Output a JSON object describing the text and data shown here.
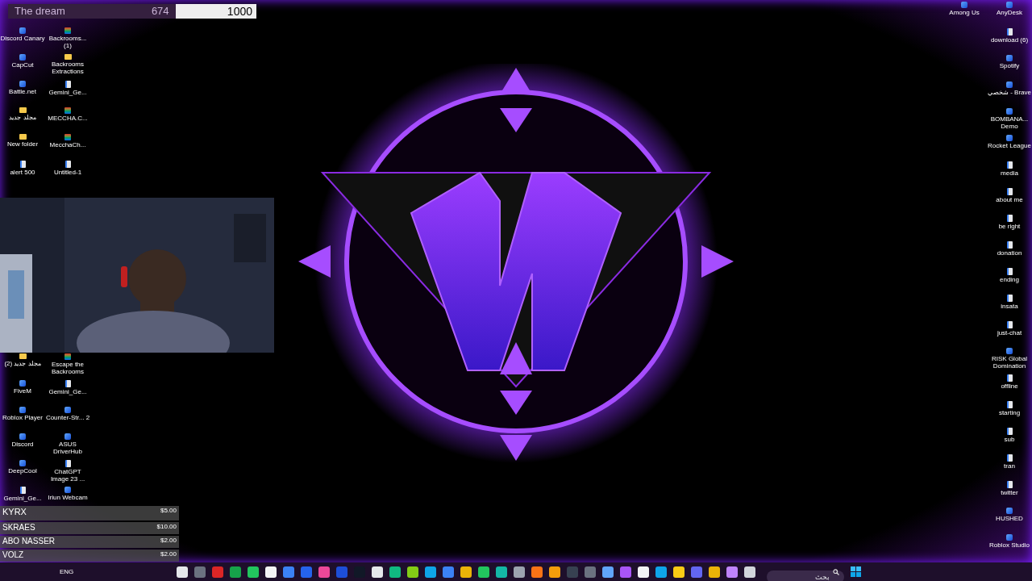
{
  "goal": {
    "title": "The dream",
    "current": "674",
    "target": "1000",
    "level": 0.674
  },
  "left_top": [
    {
      "label": "Discord Canary",
      "kind": "app"
    },
    {
      "label": "Backrooms... (1)",
      "kind": "archive"
    },
    {
      "label": "CapCut",
      "kind": "app"
    },
    {
      "label": "Backrooms Extractions",
      "kind": "folder"
    },
    {
      "label": "Battle.net",
      "kind": "app"
    },
    {
      "label": "Gemini_Ge...",
      "kind": "file"
    },
    {
      "label": "مجلد جديد",
      "kind": "folder"
    },
    {
      "label": "MECCHA.C...",
      "kind": "archive"
    },
    {
      "label": "New folder",
      "kind": "folder"
    },
    {
      "label": "MecchaCh...",
      "kind": "archive"
    },
    {
      "label": "alert 500",
      "kind": "file"
    },
    {
      "label": "Untitled-1",
      "kind": "file"
    }
  ],
  "left_bottom": [
    {
      "label": "مجلد جديد (2)",
      "kind": "folder"
    },
    {
      "label": "Escape the Backrooms",
      "kind": "archive"
    },
    {
      "label": "FiveM",
      "kind": "app"
    },
    {
      "label": "Gemini_Ge...",
      "kind": "file"
    },
    {
      "label": "Roblox Player",
      "kind": "app"
    },
    {
      "label": "Counter-Str... 2",
      "kind": "app"
    },
    {
      "label": "Discord",
      "kind": "app"
    },
    {
      "label": "ASUS DriverHub",
      "kind": "app"
    },
    {
      "label": "DeepCool",
      "kind": "app"
    },
    {
      "label": "ChatGPT Image 23 ...",
      "kind": "file"
    },
    {
      "label": "Gemini_Ge...",
      "kind": "file"
    },
    {
      "label": "Iriun Webcam",
      "kind": "app"
    }
  ],
  "right_top": [
    {
      "label": "Among Us",
      "kind": "app"
    },
    {
      "label": "AnyDesk",
      "kind": "app"
    }
  ],
  "right_column": [
    {
      "label": "download (6)",
      "kind": "file"
    },
    {
      "label": "Spotify",
      "kind": "app"
    },
    {
      "label": "شخصي - Brave",
      "kind": "app"
    },
    {
      "label": "BOMBANA... Demo",
      "kind": "app"
    },
    {
      "label": "Rocket League",
      "kind": "app"
    },
    {
      "label": "media",
      "kind": "file"
    },
    {
      "label": "about me",
      "kind": "file"
    },
    {
      "label": "be right",
      "kind": "file"
    },
    {
      "label": "donation",
      "kind": "file"
    },
    {
      "label": "ending",
      "kind": "file"
    },
    {
      "label": "insata",
      "kind": "file"
    },
    {
      "label": "just-chat",
      "kind": "file"
    },
    {
      "label": "RISK Global Domination",
      "kind": "app"
    },
    {
      "label": "offline",
      "kind": "file"
    },
    {
      "label": "starting",
      "kind": "file"
    },
    {
      "label": "sub",
      "kind": "file"
    },
    {
      "label": "tran",
      "kind": "file"
    },
    {
      "label": "twitter",
      "kind": "file"
    },
    {
      "label": "HUSHED",
      "kind": "app"
    },
    {
      "label": "Roblox Studio",
      "kind": "app"
    }
  ],
  "donations": [
    {
      "name": "KYRX",
      "amount": "$5.00"
    },
    {
      "name": "SKRAES",
      "amount": "$10.00"
    },
    {
      "name": "ABO NASSER",
      "amount": "$2.00"
    },
    {
      "name": "VOLZ",
      "amount": "$2.00"
    }
  ],
  "taskbar": {
    "tray_language": "ENG",
    "apps": [
      {
        "color": "#e5e7eb"
      },
      {
        "color": "#6b7280"
      },
      {
        "color": "#dc2626"
      },
      {
        "color": "#16a34a"
      },
      {
        "color": "#22c55e"
      },
      {
        "color": "#f3f4f6"
      },
      {
        "color": "#3b82f6"
      },
      {
        "color": "#2563eb"
      },
      {
        "color": "#ec4899"
      },
      {
        "color": "#1d4ed8"
      },
      {
        "color": "#111827"
      },
      {
        "color": "#e5e7eb"
      },
      {
        "color": "#10b981"
      },
      {
        "color": "#84cc16"
      },
      {
        "color": "#0ea5e9"
      },
      {
        "color": "#3b82f6"
      },
      {
        "color": "#eab308"
      },
      {
        "color": "#22c55e"
      },
      {
        "color": "#14b8a6"
      },
      {
        "color": "#9ca3af"
      },
      {
        "color": "#f97316"
      },
      {
        "color": "#f59e0b"
      },
      {
        "color": "#374151"
      },
      {
        "color": "#6b7280"
      },
      {
        "color": "#60a5fa"
      },
      {
        "color": "#a855f7"
      },
      {
        "color": "#f3f4f6"
      },
      {
        "color": "#0ea5e9"
      },
      {
        "color": "#facc15"
      },
      {
        "color": "#6366f1"
      },
      {
        "color": "#eab308"
      },
      {
        "color": "#c084fc"
      },
      {
        "color": "#d1d5db"
      }
    ],
    "search_placeholder": "بحث"
  }
}
